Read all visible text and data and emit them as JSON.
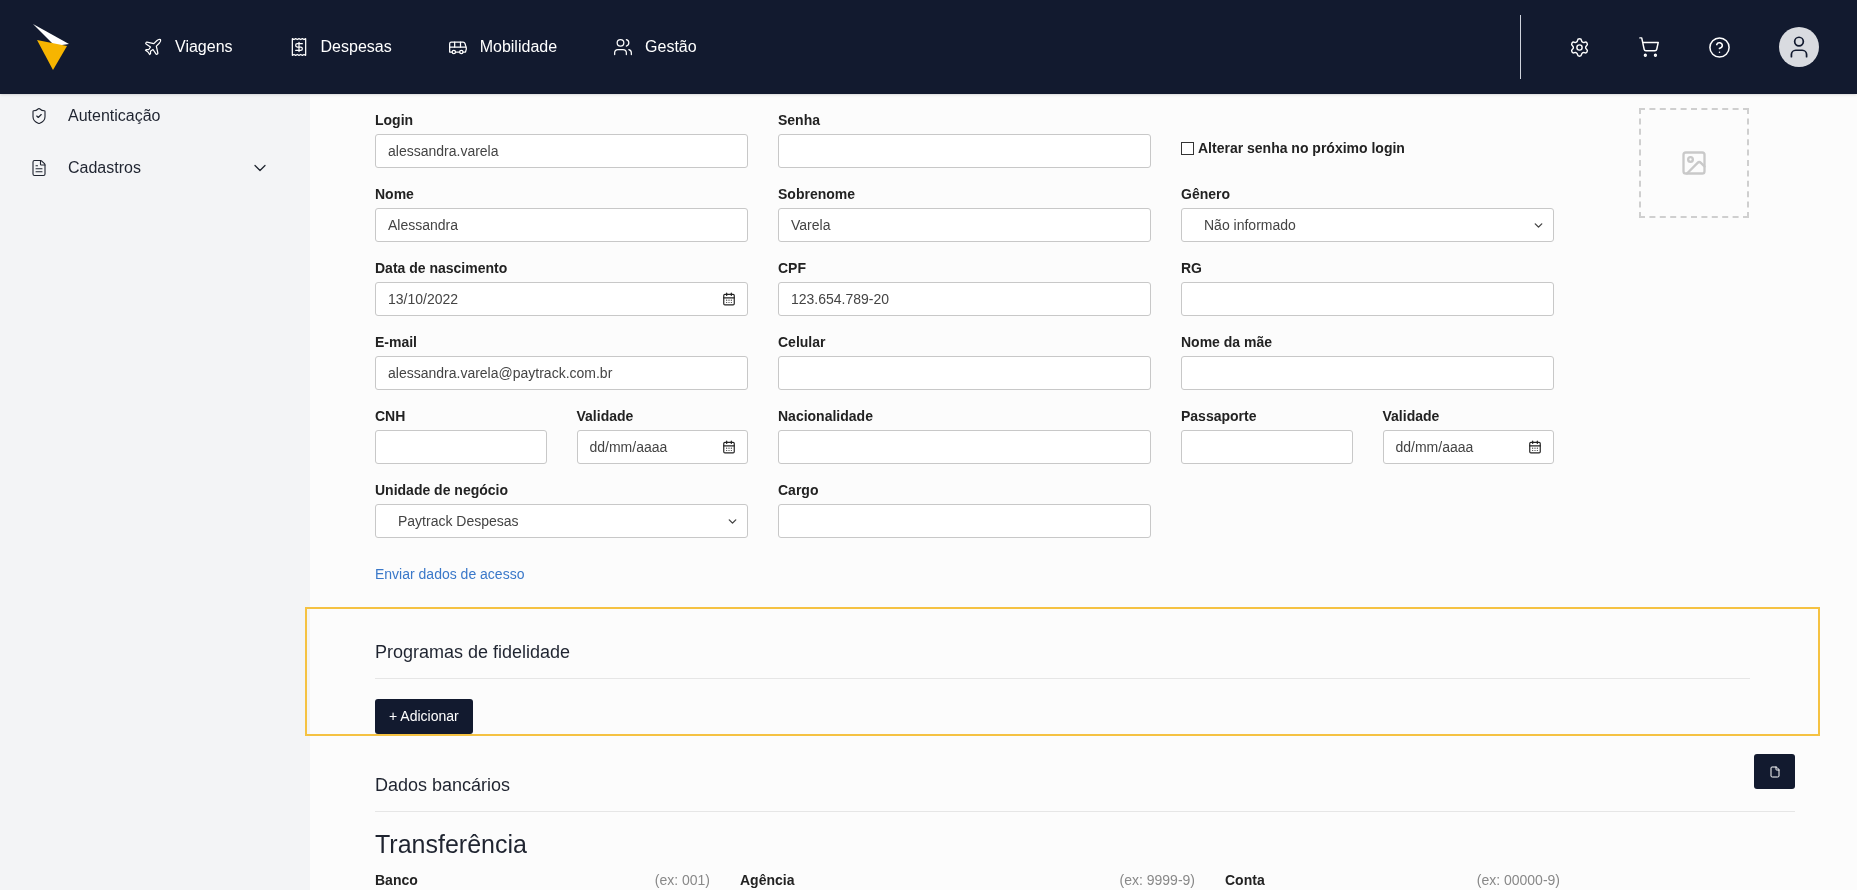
{
  "header": {
    "nav": [
      {
        "label": "Viagens"
      },
      {
        "label": "Despesas"
      },
      {
        "label": "Mobilidade"
      },
      {
        "label": "Gestão"
      }
    ]
  },
  "sidebar": {
    "items": [
      {
        "label": "Autenticação",
        "expandable": false
      },
      {
        "label": "Cadastros",
        "expandable": true
      }
    ]
  },
  "form": {
    "rows": [
      [
        {
          "items": [
            {
              "kind": "text",
              "label": "Login",
              "value": "alessandra.varela"
            }
          ]
        },
        {
          "items": [
            {
              "kind": "text",
              "label": "Senha"
            }
          ]
        },
        {
          "items": [
            {
              "kind": "checkbox",
              "label": "Alterar senha no próximo login",
              "checked": false
            }
          ]
        }
      ],
      [
        {
          "items": [
            {
              "kind": "text",
              "label": "Nome",
              "value": "Alessandra"
            }
          ]
        },
        {
          "items": [
            {
              "kind": "text",
              "label": "Sobrenome",
              "value": "Varela"
            }
          ]
        },
        {
          "items": [
            {
              "kind": "select",
              "label": "Gênero",
              "value": "Não informado"
            }
          ]
        }
      ],
      [
        {
          "items": [
            {
              "kind": "date",
              "label": "Data de nascimento",
              "value": "13/10/2022"
            }
          ]
        },
        {
          "items": [
            {
              "kind": "text",
              "label": "CPF",
              "value": "123.654.789-20"
            }
          ]
        },
        {
          "items": [
            {
              "kind": "text",
              "label": "RG"
            }
          ]
        }
      ],
      [
        {
          "items": [
            {
              "kind": "text",
              "label": "E-mail",
              "value": "alessandra.varela@paytrack.com.br"
            }
          ]
        },
        {
          "items": [
            {
              "kind": "text",
              "label": "Celular"
            }
          ]
        },
        {
          "items": [
            {
              "kind": "text",
              "label": "Nome da mãe"
            }
          ]
        }
      ],
      [
        {
          "items": [
            {
              "kind": "text",
              "label": "CNH"
            },
            {
              "kind": "date",
              "label": "Validade",
              "placeholder": "dd/mm/aaaa"
            }
          ]
        },
        {
          "items": [
            {
              "kind": "text",
              "label": "Nacionalidade"
            }
          ]
        },
        {
          "items": [
            {
              "kind": "text",
              "label": "Passaporte"
            },
            {
              "kind": "date",
              "label": "Validade",
              "placeholder": "dd/mm/aaaa"
            }
          ]
        }
      ],
      [
        {
          "items": [
            {
              "kind": "select",
              "label": "Unidade de negócio",
              "value": "Paytrack Despesas"
            }
          ]
        },
        {
          "items": [
            {
              "kind": "text",
              "label": "Cargo"
            }
          ]
        }
      ]
    ],
    "link": "Enviar dados de acesso"
  },
  "loyalty": {
    "title": "Programas de fidelidade",
    "button": "+ Adicionar"
  },
  "bank": {
    "title": "Dados bancários",
    "subtitle": "Transferência",
    "fields": [
      {
        "label": "Banco",
        "hint": "(ex: 001)"
      },
      {
        "label": "Agência",
        "hint": "(ex: 9999-9)"
      },
      {
        "label": "Conta",
        "hint": "(ex: 00000-9)"
      }
    ]
  }
}
